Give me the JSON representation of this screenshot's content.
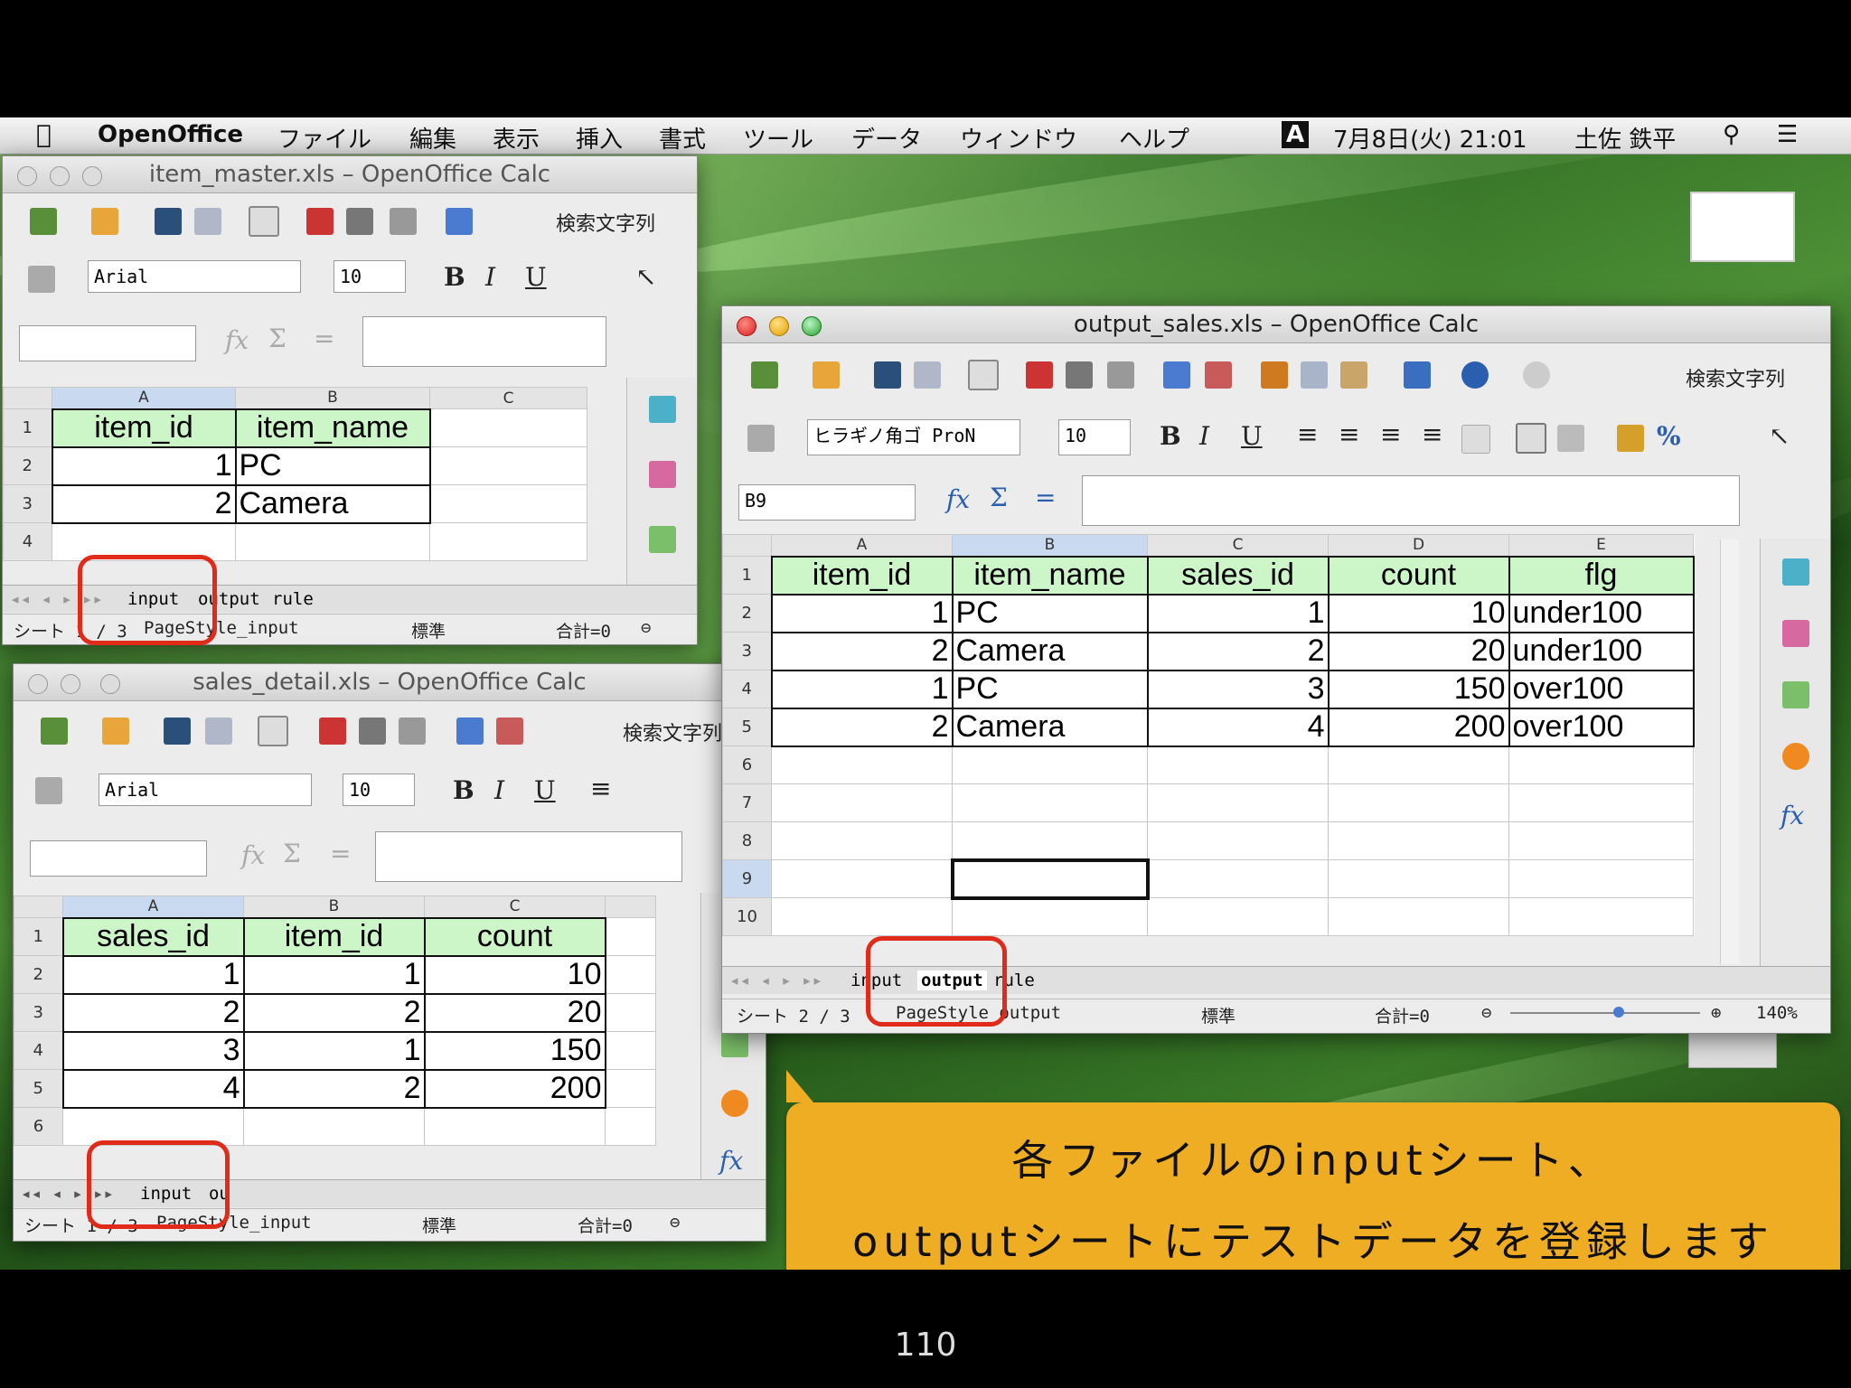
{
  "menubar": {
    "app_name": "OpenOffice",
    "items": [
      "ファイル",
      "編集",
      "表示",
      "挿入",
      "書式",
      "ツール",
      "データ",
      "ウィンドウ",
      "ヘルプ"
    ],
    "input_indicator": "A",
    "datetime": "7月8日(火)  21:01",
    "user": "土佐 鉄平"
  },
  "win1": {
    "title": "item_master.xls – OpenOffice Calc",
    "find_label": "検索文字列",
    "font_name": "Arial",
    "font_size": "10",
    "cols": [
      "A",
      "B",
      "C"
    ],
    "rows": [
      "1",
      "2",
      "3",
      "4"
    ],
    "cells": [
      [
        "item_id",
        "item_name"
      ],
      [
        "1",
        "PC"
      ],
      [
        "2",
        "Camera"
      ]
    ],
    "tabs": [
      "input",
      "output",
      "rule"
    ],
    "status_sheet": "シート 1 / 3",
    "status_style": "PageStyle_input",
    "status_mode": "標準",
    "status_sum": "合計=0"
  },
  "win2": {
    "title": "sales_detail.xls – OpenOffice Calc",
    "find_label": "検索文字列",
    "font_name": "Arial",
    "font_size": "10",
    "cols": [
      "A",
      "B",
      "C"
    ],
    "rows": [
      "1",
      "2",
      "3",
      "4",
      "5",
      "6"
    ],
    "cells": [
      [
        "sales_id",
        "item_id",
        "count"
      ],
      [
        "1",
        "1",
        "10"
      ],
      [
        "2",
        "2",
        "20"
      ],
      [
        "3",
        "1",
        "150"
      ],
      [
        "4",
        "2",
        "200"
      ]
    ],
    "tabs": [
      "input",
      "ou"
    ],
    "status_sheet": "シート 1 / 3",
    "status_style": "PageStyle_input",
    "status_mode": "標準",
    "status_sum": "合計=0"
  },
  "win3": {
    "title": "output_sales.xls – OpenOffice Calc",
    "find_label": "検索文字列",
    "font_name": "ヒラギノ角ゴ ProN",
    "font_size": "10",
    "cell_ref": "B9",
    "cols": [
      "A",
      "B",
      "C",
      "D",
      "E"
    ],
    "rows": [
      "1",
      "2",
      "3",
      "4",
      "5",
      "6",
      "7",
      "8",
      "9",
      "10"
    ],
    "cells": [
      [
        "item_id",
        "item_name",
        "sales_id",
        "count",
        "flg"
      ],
      [
        "1",
        "PC",
        "1",
        "10",
        "under100"
      ],
      [
        "2",
        "Camera",
        "2",
        "20",
        "under100"
      ],
      [
        "1",
        "PC",
        "3",
        "150",
        "over100"
      ],
      [
        "2",
        "Camera",
        "4",
        "200",
        "over100"
      ]
    ],
    "tabs": [
      "input",
      "output",
      "rule"
    ],
    "status_sheet": "シート 2 / 3",
    "status_style": "PageStyle_output",
    "status_mode": "標準",
    "status_sum": "合計=0",
    "zoom": "140%"
  },
  "callout": {
    "line1": "各ファイルのinputシート、",
    "line2": "outputシートにテストデータを登録します"
  },
  "page_number": "110",
  "colors": {
    "header_fill": "#ccf6c8",
    "callout": "#efad23",
    "highlight_ring": "#e02a1a"
  }
}
